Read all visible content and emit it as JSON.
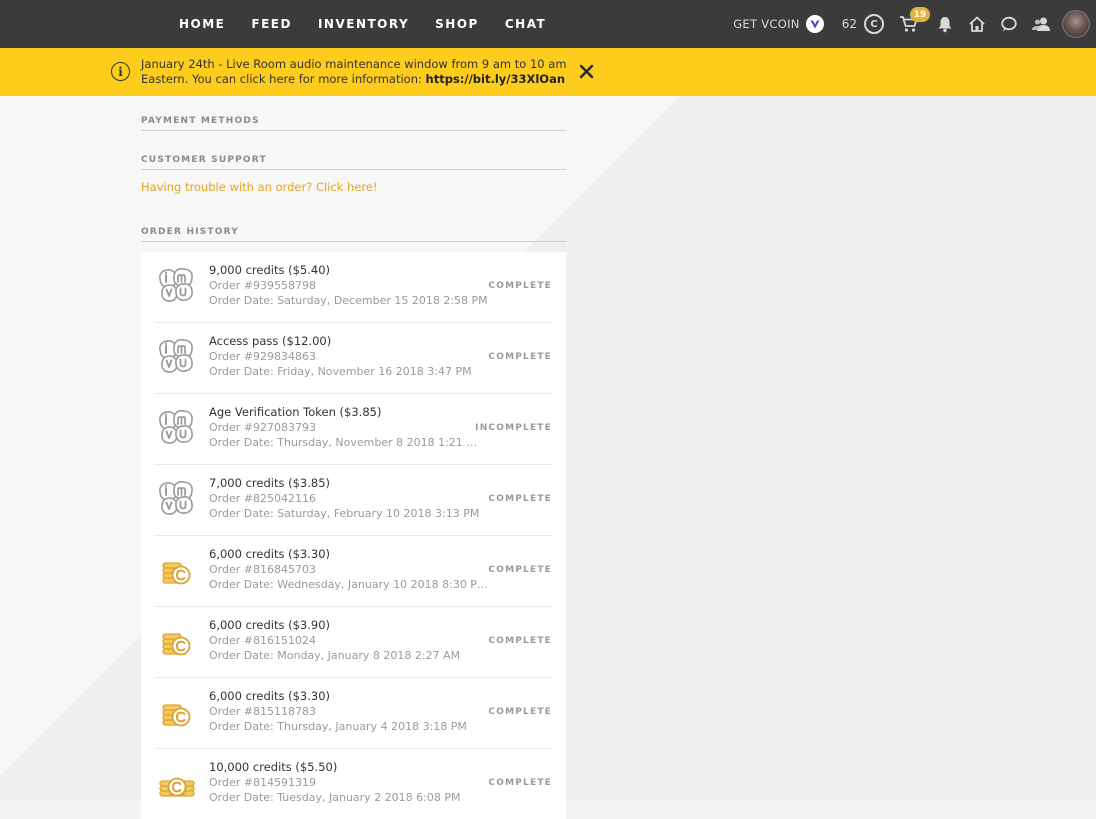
{
  "nav": {
    "links": [
      "HOME",
      "FEED",
      "INVENTORY",
      "SHOP",
      "CHAT"
    ],
    "get_vcoin": "GET VCOIN",
    "credits": "62",
    "cart_count": "19"
  },
  "banner": {
    "text": "January 24th - Live Room audio maintenance window from 9 am to 10 am Eastern. You can click here for more information:",
    "link": "https://bit.ly/33XlOan"
  },
  "sections": {
    "payment_methods": "PAYMENT METHODS",
    "customer_support": "CUSTOMER SUPPORT",
    "support_link": "Having trouble with an order? Click here!",
    "order_history": "ORDER HISTORY"
  },
  "orders": [
    {
      "title": "9,000 credits ($5.40)",
      "number": "Order #939558798",
      "date": "Order Date: Saturday, December 15 2018 2:58 PM",
      "status": "COMPLETE",
      "logo": "imvu-logo-icon"
    },
    {
      "title": "Access pass ($12.00)",
      "number": "Order #929834863",
      "date": "Order Date: Friday, November 16 2018 3:47 PM",
      "status": "COMPLETE",
      "logo": "imvu-logo-icon"
    },
    {
      "title": "Age Verification Token ($3.85)",
      "number": "Order #927083793",
      "date": "Order Date: Thursday, November 8 2018 1:21 …",
      "status": "INCOMPLETE",
      "logo": "imvu-logo-icon"
    },
    {
      "title": "7,000 credits ($3.85)",
      "number": "Order #825042116",
      "date": "Order Date: Saturday, February 10 2018 3:13 PM",
      "status": "COMPLETE",
      "logo": "imvu-logo-icon"
    },
    {
      "title": "6,000 credits ($3.30)",
      "number": "Order #816845703",
      "date": "Order Date: Wednesday, January 10 2018 8:30 P…",
      "status": "COMPLETE",
      "logo": "coin-stack-icon"
    },
    {
      "title": "6,000 credits ($3.90)",
      "number": "Order #816151024",
      "date": "Order Date: Monday, January 8 2018 2:27 AM",
      "status": "COMPLETE",
      "logo": "coin-stack-icon"
    },
    {
      "title": "6,000 credits ($3.30)",
      "number": "Order #815118783",
      "date": "Order Date: Thursday, January 4 2018 3:18 PM",
      "status": "COMPLETE",
      "logo": "coin-stack-icon"
    },
    {
      "title": "10,000 credits ($5.50)",
      "number": "Order #814591319",
      "date": "Order Date: Tuesday, January 2 2018 6:08 PM",
      "status": "COMPLETE",
      "logo": "coin-stack-large-icon"
    }
  ],
  "colors": {
    "nav_bg": "#3b3b3b",
    "banner_bg": "#fdcc1c",
    "accent": "#e5a520"
  }
}
